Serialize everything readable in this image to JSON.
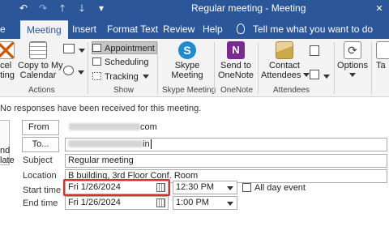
{
  "titlebar": {
    "title": "Regular meeting  -  Meeting",
    "qat": [
      "save-icon",
      "undo-icon",
      "redo-icon",
      "up-arrow-icon",
      "down-arrow-icon",
      "more-icon"
    ],
    "close_glyph": "✕"
  },
  "tabs": {
    "file_partial": "e",
    "items": [
      "Meeting",
      "Insert",
      "Format Text",
      "Review",
      "Help"
    ],
    "active": "Meeting",
    "tellme": "Tell me what you want to do"
  },
  "ribbon": {
    "cancel_label": "ncel\neting",
    "copy_label": "Copy to My\nCalendar",
    "actions_label": "Actions",
    "appointment_label": "Appointment",
    "scheduling_label": "Scheduling",
    "tracking_label": "Tracking",
    "show_label": "Show",
    "skype_label": "Skype\nMeeting",
    "skype_group_label": "Skype Meeting",
    "onenote_label": "Send to\nOneNote",
    "onenote_group_label": "OneNote",
    "contact_label": "Contact\nAttendees",
    "attendees_group_label": "Attendees",
    "options_label": "Options",
    "tags_partial": "Ta"
  },
  "form": {
    "info": "No responses have been received for this meeting.",
    "left_button_label": "nd\nlate",
    "from_label": "From",
    "from_value": "com",
    "to_label": "To...",
    "to_value": "in",
    "subject_label": "Subject",
    "subject_value": "Regular meeting",
    "location_label": "Location",
    "location_value": "B building, 3rd Floor Conf. Room",
    "start_label": "Start time",
    "start_date": "Fri 1/26/2024",
    "start_time": "12:30 PM",
    "all_day_label": "All day event",
    "end_label": "End time",
    "end_date": "Fri 1/26/2024",
    "end_time": "1:00 PM"
  },
  "colors": {
    "titlebar": "#2b579a",
    "ribbon_bg": "#f3f3f3",
    "highlight": "#d9302a",
    "skype": "#1e8bd1",
    "onenote": "#7a2b91"
  }
}
